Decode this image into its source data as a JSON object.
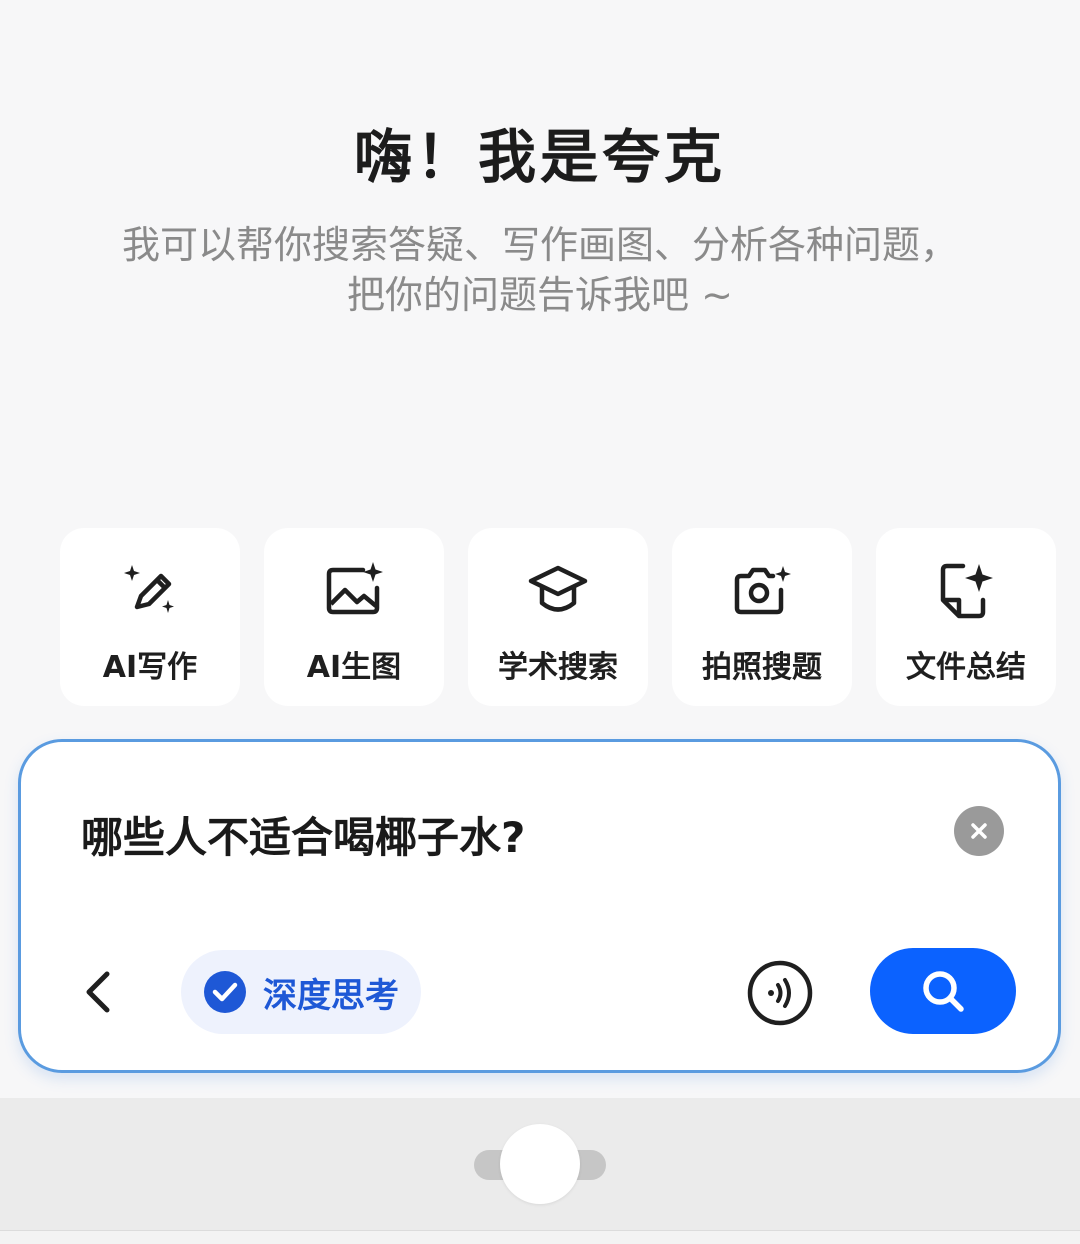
{
  "header": {
    "greeting": "嗨！我是夸克",
    "subtitle_line1": "我可以帮你搜索答疑、写作画图、分析各种问题，",
    "subtitle_line2": "把你的问题告诉我吧 ~"
  },
  "shortcuts": [
    {
      "label": "AI写作",
      "icon": "ai-write-icon"
    },
    {
      "label": "AI生图",
      "icon": "ai-image-icon"
    },
    {
      "label": "学术搜索",
      "icon": "graduation-cap-icon"
    },
    {
      "label": "拍照搜题",
      "icon": "camera-icon"
    },
    {
      "label": "文件总结",
      "icon": "document-sparkle-icon"
    }
  ],
  "input": {
    "query": "哪些人不适合喝椰子水?",
    "deep_think_label": "深度思考",
    "deep_think_checked": true
  },
  "colors": {
    "accent": "#0b62ff",
    "deep_think_text": "#1e58d6",
    "card_border": "#5a9be0"
  }
}
